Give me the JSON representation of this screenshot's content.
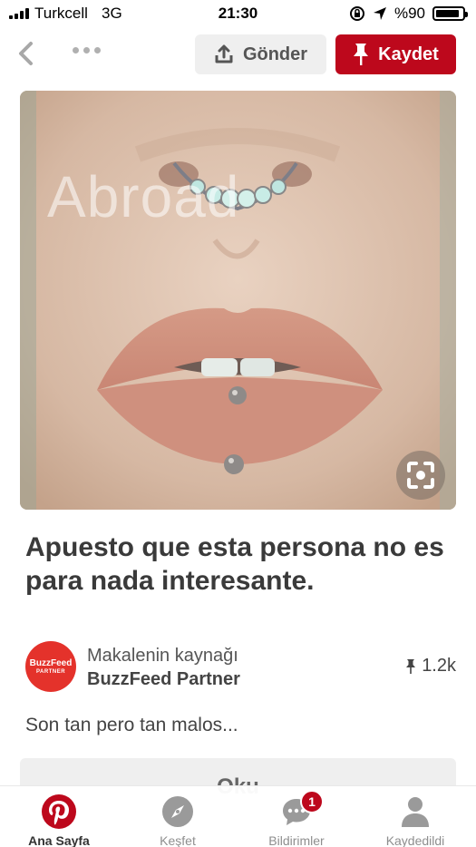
{
  "status_bar": {
    "carrier": "Turkcell",
    "network": "3G",
    "time": "21:30",
    "battery": "%90",
    "battery_level": 0.9
  },
  "top_nav": {
    "send_label": "Gönder",
    "save_label": "Kaydet"
  },
  "pin": {
    "watermark": "Abroad",
    "title": "Apuesto que esta persona no es para nada interesante.",
    "source_label": "Makalenin kaynağı",
    "source_name": "BuzzFeed Partner",
    "avatar_line1": "BuzzFeed",
    "avatar_line2": "PARTNER",
    "save_count": "1.2k",
    "description": "Son tan pero tan malos...",
    "read_label": "Oku"
  },
  "tab_bar": {
    "items": [
      {
        "label": "Ana Sayfa",
        "icon": "pinterest-logo-icon",
        "active": true
      },
      {
        "label": "Keşfet",
        "icon": "compass-icon",
        "active": false
      },
      {
        "label": "Bildirimler",
        "icon": "chat-bubble-icon",
        "active": false,
        "badge": "1"
      },
      {
        "label": "Kaydedildi",
        "icon": "person-icon",
        "active": false
      }
    ]
  },
  "colors": {
    "brand_red": "#bd081c",
    "buzzfeed_red": "#e4322b",
    "button_gray": "#efefef"
  }
}
